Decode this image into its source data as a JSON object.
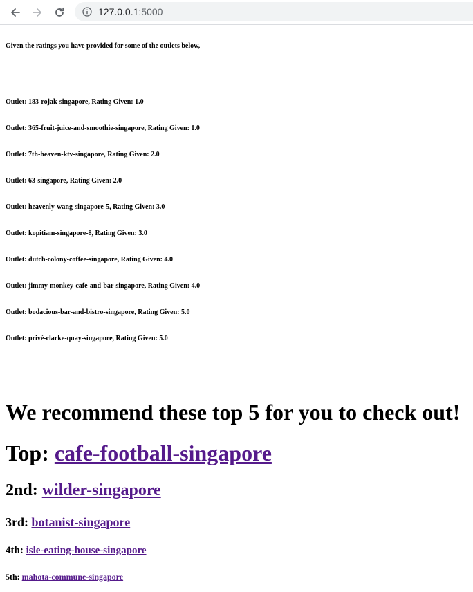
{
  "browser": {
    "url_host": "127.0.0.1",
    "url_port": ":5000"
  },
  "page": {
    "intro": "Given the ratings you have provided for some of the outlets below,",
    "ratings": [
      "Outlet: 183-rojak-singapore, Rating Given: 1.0",
      "Outlet: 365-fruit-juice-and-smoothie-singapore, Rating Given: 1.0",
      "Outlet: 7th-heaven-ktv-singapore, Rating Given: 2.0",
      "Outlet: 63-singapore, Rating Given: 2.0",
      "Outlet: heavenly-wang-singapore-5, Rating Given: 3.0",
      "Outlet: kopitiam-singapore-8, Rating Given: 3.0",
      "Outlet: dutch-colony-coffee-singapore, Rating Given: 4.0",
      "Outlet: jimmy-monkey-cafe-and-bar-singapore, Rating Given: 4.0",
      "Outlet: bodacious-bar-and-bistro-singapore, Rating Given: 5.0",
      "Outlet: privé-clarke-quay-singapore, Rating Given: 5.0"
    ],
    "recommend_heading": "We recommend these top 5 for you to check out!",
    "recommendations": [
      {
        "rank": "Top: ",
        "name": "cafe-football-singapore"
      },
      {
        "rank": "2nd: ",
        "name": "wilder-singapore"
      },
      {
        "rank": "3rd: ",
        "name": "botanist-singapore"
      },
      {
        "rank": "4th: ",
        "name": "isle-eating-house-singapore"
      },
      {
        "rank": "5th: ",
        "name": "mahota-commune-singapore"
      }
    ]
  },
  "colors": {
    "link_visited": "#551a8b",
    "toolbar_bg": "#ffffff",
    "omnibox_bg": "#f1f3f4"
  },
  "icons": {
    "back": "arrow-left-icon",
    "forward": "arrow-right-icon",
    "reload": "reload-icon",
    "site_info": "info-icon"
  }
}
